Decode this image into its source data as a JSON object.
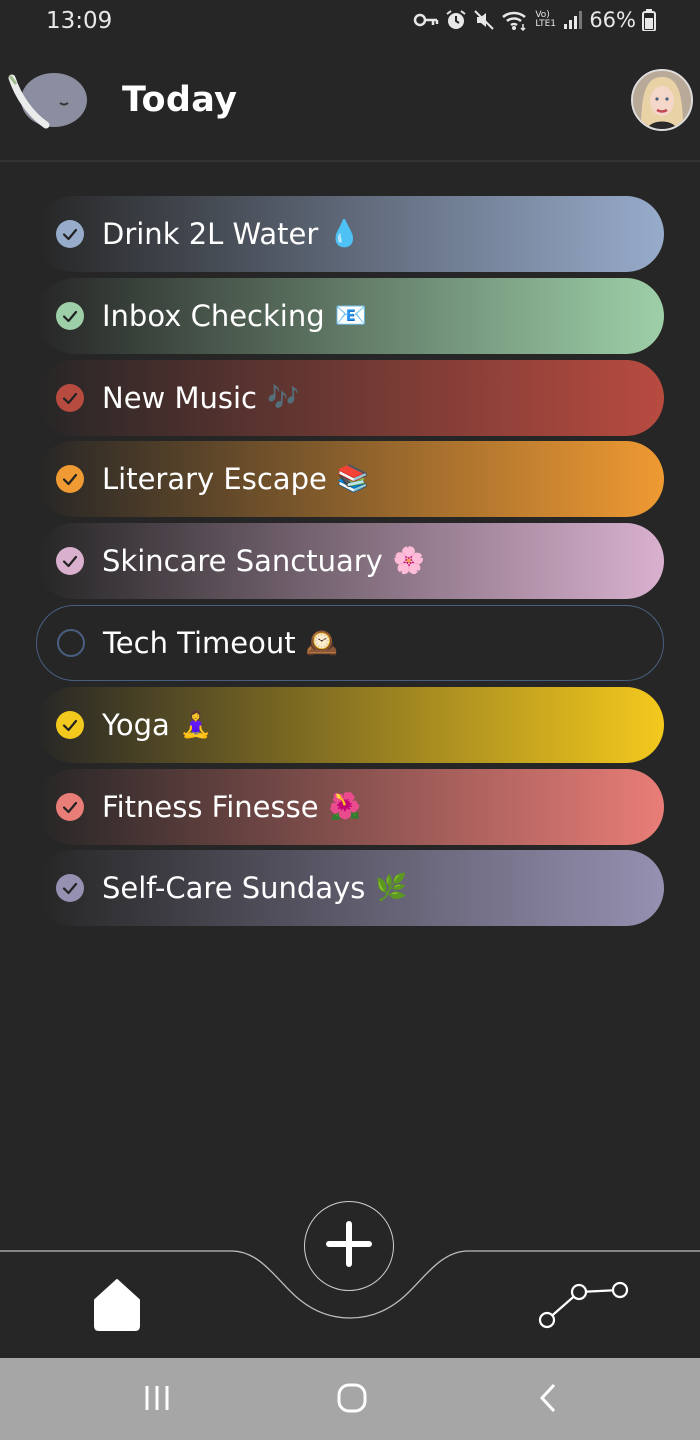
{
  "status_bar": {
    "time": "13:09",
    "network_label": "Vo) LTE1",
    "battery": "66%",
    "icons": [
      "key-icon",
      "alarm-icon",
      "mute-icon",
      "wifi-icon",
      "signal-icon",
      "battery-icon"
    ]
  },
  "header": {
    "title": "Today",
    "logo_icon": "whale-logo-icon",
    "avatar_icon": "user-avatar"
  },
  "habits": [
    {
      "label": "Drink 2L Water",
      "emoji": "💧",
      "color": "#97abcb",
      "done": true
    },
    {
      "label": "Inbox Checking",
      "emoji": "📧",
      "color": "#9dcfa8",
      "done": true
    },
    {
      "label": "New Music",
      "emoji": "🎶",
      "color": "#b84b40",
      "done": true
    },
    {
      "label": "Literary Escape",
      "emoji": "📚",
      "color": "#ef9a32",
      "done": true
    },
    {
      "label": "Skincare Sanctuary",
      "emoji": "🌸",
      "color": "#d9b1cf",
      "done": true
    },
    {
      "label": "Tech Timeout",
      "emoji": "🕰️",
      "color": "#4a5f80",
      "done": false
    },
    {
      "label": "Yoga",
      "emoji": "🧘‍♀️",
      "color": "#f4c91d",
      "done": true
    },
    {
      "label": "Fitness Finesse",
      "emoji": "🌺",
      "color": "#e97d77",
      "done": true
    },
    {
      "label": "Self-Care Sundays",
      "emoji": "🌿",
      "color": "#9690b1",
      "done": true
    }
  ],
  "nav": {
    "items": [
      {
        "name": "home-tab",
        "icon": "home-icon",
        "active": true
      },
      {
        "name": "add-habit-button",
        "icon": "plus-icon"
      },
      {
        "name": "stats-tab",
        "icon": "graph-icon",
        "active": false
      }
    ]
  },
  "system_nav": {
    "buttons": [
      "recent-apps-icon",
      "home-circle-icon",
      "back-chevron-icon"
    ]
  }
}
